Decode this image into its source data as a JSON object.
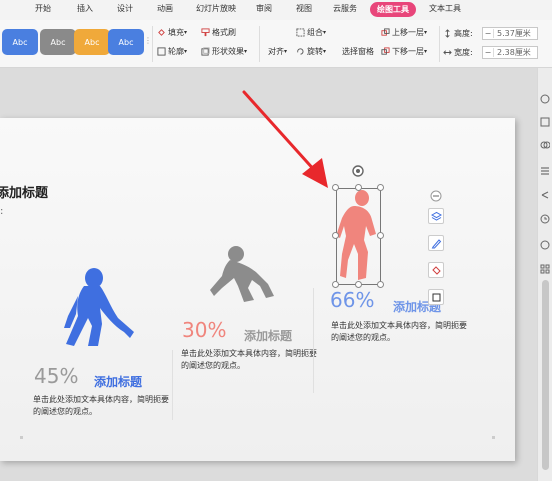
{
  "tabs": [
    "开始",
    "插入",
    "设计",
    "动画",
    "幻灯片放映",
    "审阅",
    "视图",
    "云服务",
    "绘图工具",
    "文本工具"
  ],
  "ribbon": {
    "styles": [
      {
        "label": "Abc",
        "color": "#4a7fe0"
      },
      {
        "label": "Abc",
        "color": "#8a8a8a"
      },
      {
        "label": "Abc",
        "color": "#f0a93a"
      },
      {
        "label": "Abc",
        "color": "#4a7fe0"
      }
    ],
    "fill": "填充",
    "format_brush": "格式刷",
    "outline": "轮廓",
    "shape_effect": "形状效果",
    "group": "组合",
    "align": "对齐",
    "rotate": "旋转",
    "selection_pane": "选择窗格",
    "bring_forward": "上移一层",
    "send_backward": "下移一层",
    "height_label": "高度:",
    "height_value": "5.37厘米",
    "width_label": "宽度:",
    "width_value": "2.38厘米"
  },
  "slide": {
    "heading": "添加标题",
    "items": [
      {
        "percent": "45%",
        "title": "添加标题",
        "text": "单击此处添加文本具体内容，简明扼要的阐述您的观点。"
      },
      {
        "percent": "30%",
        "title": "添加标题",
        "text": "单击此处添加文本具体内容，简明扼要的阐述您的观点。"
      },
      {
        "percent": "66%",
        "title": "添加标题",
        "text": "单击此处添加文本具体内容，简明扼要的阐述您的观点。"
      }
    ]
  },
  "colors": {
    "accent_tab": "#e8457a",
    "blue": "#3f6fe0",
    "gray": "#8c8c8c",
    "coral": "#f0857d",
    "red_arrow": "#e8282c"
  }
}
